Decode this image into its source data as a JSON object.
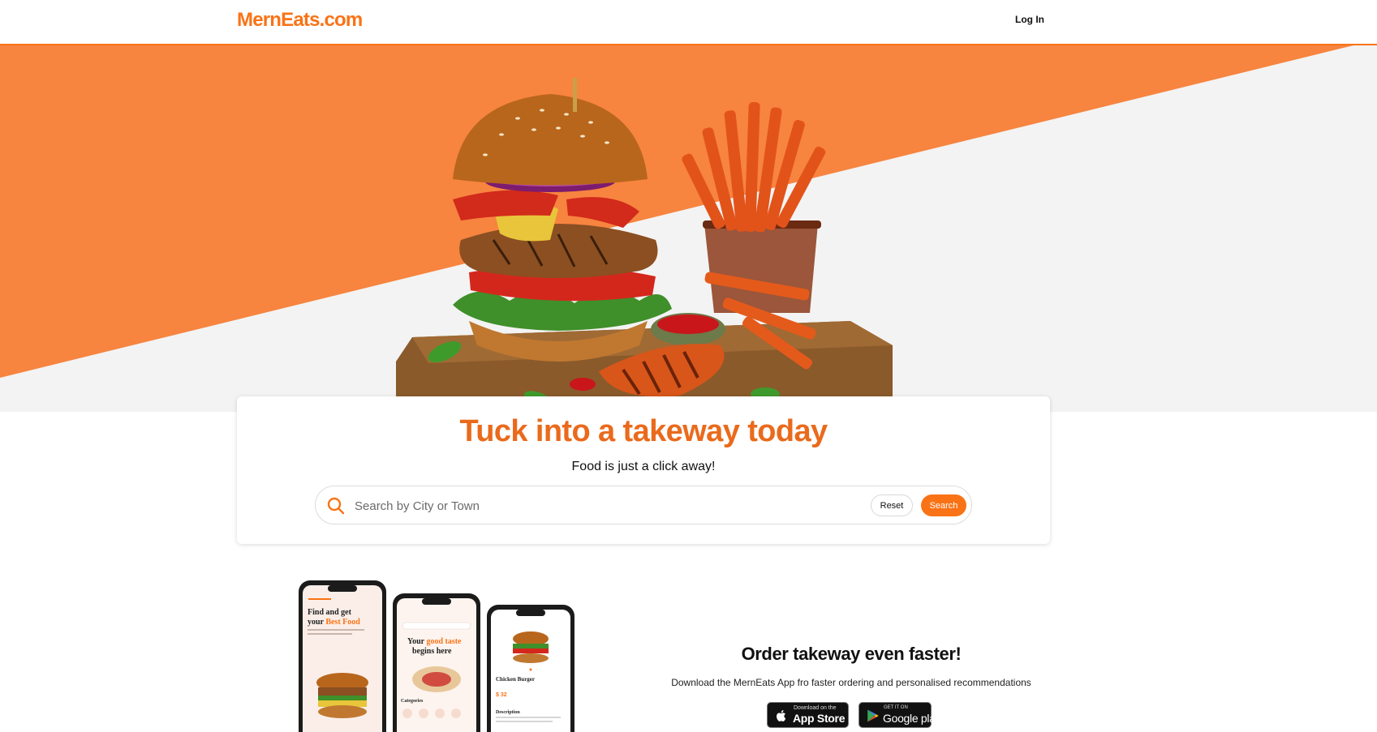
{
  "header": {
    "logo": "MernEats.com",
    "login_label": "Log In"
  },
  "hero": {
    "image_icon": "burger-and-fries-image"
  },
  "search_card": {
    "title": "Tuck into a takeway today",
    "subtitle": "Food is just a click away!",
    "search_placeholder": "Search by City or Town",
    "reset_label": "Reset",
    "search_label": "Search"
  },
  "app_promo": {
    "title": "Order takeway even faster!",
    "subtitle": "Download the MernEats App fro faster ordering and personalised recommendations",
    "app_store": {
      "small": "Download on the",
      "big": "App Store"
    },
    "google_play": {
      "small": "GET IT ON",
      "big": "Google play"
    },
    "phone1": {
      "line1": "Find and get",
      "line2a": "your ",
      "line2b": "Best Food"
    },
    "phone2": {
      "line1a": "Your ",
      "line1b": "good taste",
      "line2": "begins here",
      "categories": "Categories"
    },
    "phone3": {
      "name": "Chicken Burger",
      "price": "$ 32",
      "description": "Description"
    }
  },
  "colors": {
    "brand": "#f97316",
    "title": "#ea6a1c",
    "hero_bg": "#f3f3f3"
  }
}
